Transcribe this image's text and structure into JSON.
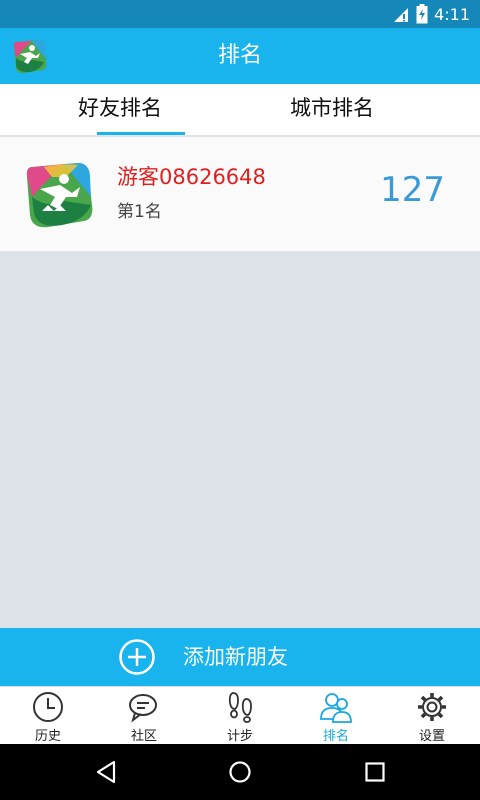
{
  "status_bar": {
    "time": "4:11"
  },
  "app_bar": {
    "title": "排名"
  },
  "tabs": [
    {
      "label": "好友排名",
      "active": true
    },
    {
      "label": "城市排名",
      "active": false
    }
  ],
  "ranking": {
    "items": [
      {
        "name": "游客08626648",
        "rank_text": "第1名",
        "score": "127"
      }
    ]
  },
  "add_friend": {
    "label": "添加新朋友"
  },
  "bottom_nav": {
    "items": [
      {
        "label": "历史",
        "icon": "clock-icon"
      },
      {
        "label": "社区",
        "icon": "chat-bubbles-icon"
      },
      {
        "label": "计步",
        "icon": "footprints-icon"
      },
      {
        "label": "排名",
        "icon": "people-icon",
        "active": true
      },
      {
        "label": "设置",
        "icon": "gear-icon"
      }
    ]
  },
  "colors": {
    "primary": "#19b4ee",
    "status_bar": "#1587b8",
    "name_red": "#e02020",
    "score_blue": "#3a9ad9",
    "background": "#dde1e8"
  }
}
